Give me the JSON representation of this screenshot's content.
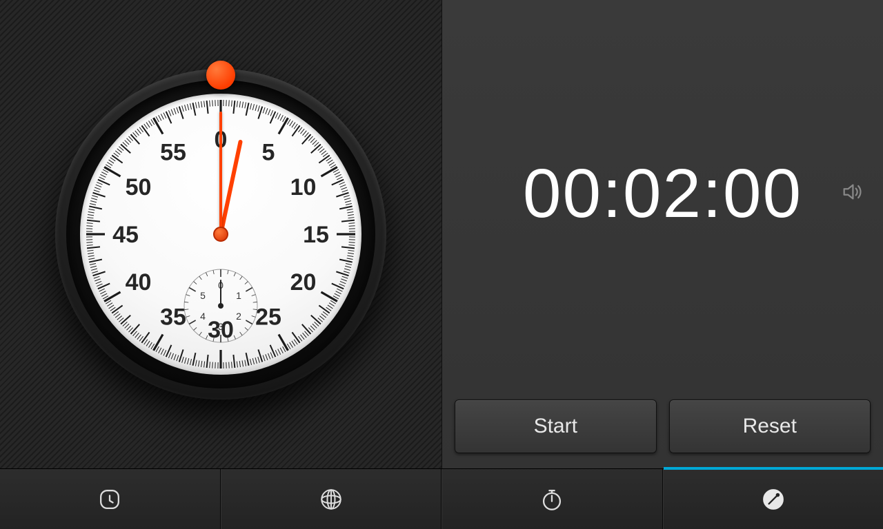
{
  "timer": {
    "display": "00:02:00",
    "minute_hand_angle_deg": 12,
    "second_hand_angle_deg": 0,
    "sound_enabled": true
  },
  "buttons": {
    "start_label": "Start",
    "reset_label": "Reset"
  },
  "dial": {
    "major_numbers": [
      "0",
      "5",
      "10",
      "15",
      "20",
      "25",
      "30",
      "35",
      "40",
      "45",
      "50",
      "55"
    ],
    "sub_numbers": [
      "0",
      "1",
      "2",
      "3",
      "4",
      "5"
    ]
  },
  "tabs": {
    "items": [
      {
        "id": "alarm",
        "icon": "alarm-clock-icon",
        "active": false
      },
      {
        "id": "worldclock",
        "icon": "globe-icon",
        "active": false
      },
      {
        "id": "stopwatch",
        "icon": "stopwatch-icon",
        "active": false
      },
      {
        "id": "timer",
        "icon": "timer-icon",
        "active": true
      }
    ]
  },
  "colors": {
    "accent": "#00a8d6",
    "hand": "#ff4000"
  }
}
